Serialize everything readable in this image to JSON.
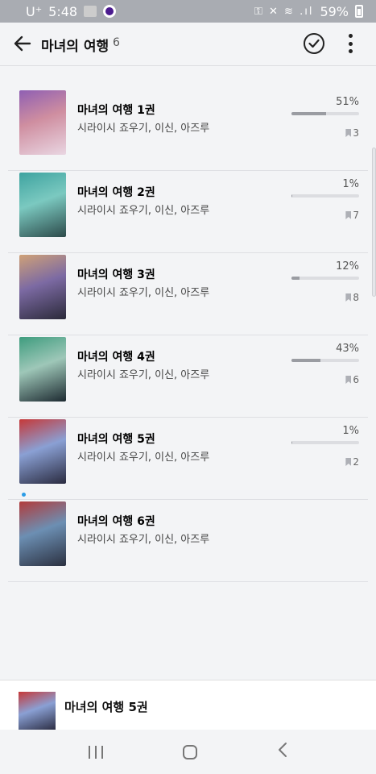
{
  "status": {
    "carrier": "U⁺",
    "time": "5:48",
    "battery": "59%"
  },
  "header": {
    "title": "마녀의 여행",
    "count": "6"
  },
  "books": [
    {
      "title": "마녀의 여행 1권",
      "author": "시라이시 죠우기, 이신, 아즈루",
      "progress_text": "51%",
      "progress": 0.51,
      "bookmarks": "3",
      "colors": [
        "#8f5fb3",
        "#cf8ea0",
        "#e9d6e2"
      ]
    },
    {
      "title": "마녀의 여행 2권",
      "author": "시라이시 죠우기, 이신, 아즈루",
      "progress_text": "1%",
      "progress": 0.01,
      "bookmarks": "7",
      "colors": [
        "#3ea3a0",
        "#7bc9c0",
        "#2c4a4a"
      ]
    },
    {
      "title": "마녀의 여행 3권",
      "author": "시라이시 죠우기, 이신, 아즈루",
      "progress_text": "12%",
      "progress": 0.12,
      "bookmarks": "8",
      "colors": [
        "#cfa177",
        "#7c6aa3",
        "#2b2a3a"
      ]
    },
    {
      "title": "마녀의 여행 4권",
      "author": "시라이시 죠우기, 이신, 아즈루",
      "progress_text": "43%",
      "progress": 0.43,
      "bookmarks": "6",
      "colors": [
        "#3e9c7e",
        "#9ec7b8",
        "#1d2a31"
      ]
    },
    {
      "title": "마녀의 여행 5권",
      "author": "시라이시 죠우기, 이신, 아즈루",
      "progress_text": "1%",
      "progress": 0.01,
      "bookmarks": "2",
      "colors": [
        "#c63838",
        "#8aa0d4",
        "#2a2b40"
      ]
    },
    {
      "title": "마녀의 여행 6권",
      "author": "시라이시 죠우기, 이신, 아즈루",
      "progress_text": "",
      "progress": 0,
      "bookmarks": "",
      "colors": [
        "#b23b3b",
        "#6c8fb3",
        "#2b3040"
      ]
    }
  ],
  "mini_player": {
    "title": "마녀의 여행 5권"
  }
}
